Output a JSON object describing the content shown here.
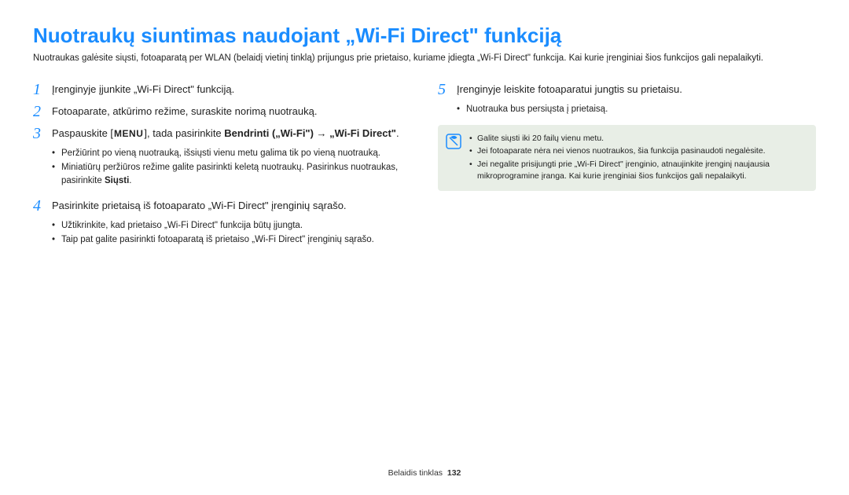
{
  "title": "Nuotraukų siuntimas naudojant „Wi-Fi Direct\" funkciją",
  "intro": "Nuotraukas galėsite siųsti, fotoaparatą per WLAN (belaidį vietinį tinklą) prijungus prie prietaiso, kuriame įdiegta „Wi-Fi Direct\" funkcija. Kai kurie įrenginiai šios funkcijos gali nepalaikyti.",
  "left": {
    "step1": {
      "num": "1",
      "text": "Įrenginyje įjunkite „Wi-Fi Direct\" funkciją."
    },
    "step2": {
      "num": "2",
      "text": "Fotoaparate, atkūrimo režime, suraskite norimą nuotrauką."
    },
    "step3": {
      "num": "3",
      "pre": "Paspauskite [",
      "menu": "MENU",
      "mid": "], tada pasirinkite ",
      "bold1": "Bendrinti („Wi-Fi\")",
      "arrow_sep": " ",
      "bold2": "„Wi-Fi Direct\"",
      "end": ".",
      "bullets": [
        "Peržiūrint po vieną nuotrauką, išsiųsti vienu metu galima tik po vieną nuotrauką.",
        "Miniatiūrų peržiūros režime galite pasirinkti keletą nuotraukų. Pasirinkus nuotraukas, pasirinkite "
      ],
      "bullets_bold_tail": "Siųsti"
    },
    "step4": {
      "num": "4",
      "text": "Pasirinkite prietaisą iš fotoaparato „Wi-Fi Direct\" įrenginių sąrašo.",
      "bullets": [
        "Užtikrinkite, kad prietaiso „Wi-Fi Direct\" funkcija būtų įjungta.",
        "Taip pat galite pasirinkti fotoaparatą iš prietaiso „Wi-Fi Direct\" įrenginių sąrašo."
      ]
    }
  },
  "right": {
    "step5": {
      "num": "5",
      "text": "Įrenginyje leiskite fotoaparatui jungtis su prietaisu.",
      "bullets": [
        "Nuotrauka bus persiųsta į prietaisą."
      ]
    },
    "note": {
      "items": [
        "Galite siųsti iki 20 failų vienu metu.",
        "Jei fotoaparate nėra nei vienos nuotraukos, šia funkcija pasinaudoti negalėsite.",
        "Jei negalite prisijungti prie „Wi-Fi Direct\" įrenginio, atnaujinkite įrenginį naujausia mikroprogramine įranga. Kai kurie įrenginiai šios funkcijos gali nepalaikyti."
      ]
    }
  },
  "footer": {
    "section": "Belaidis tinklas",
    "page": "132"
  }
}
